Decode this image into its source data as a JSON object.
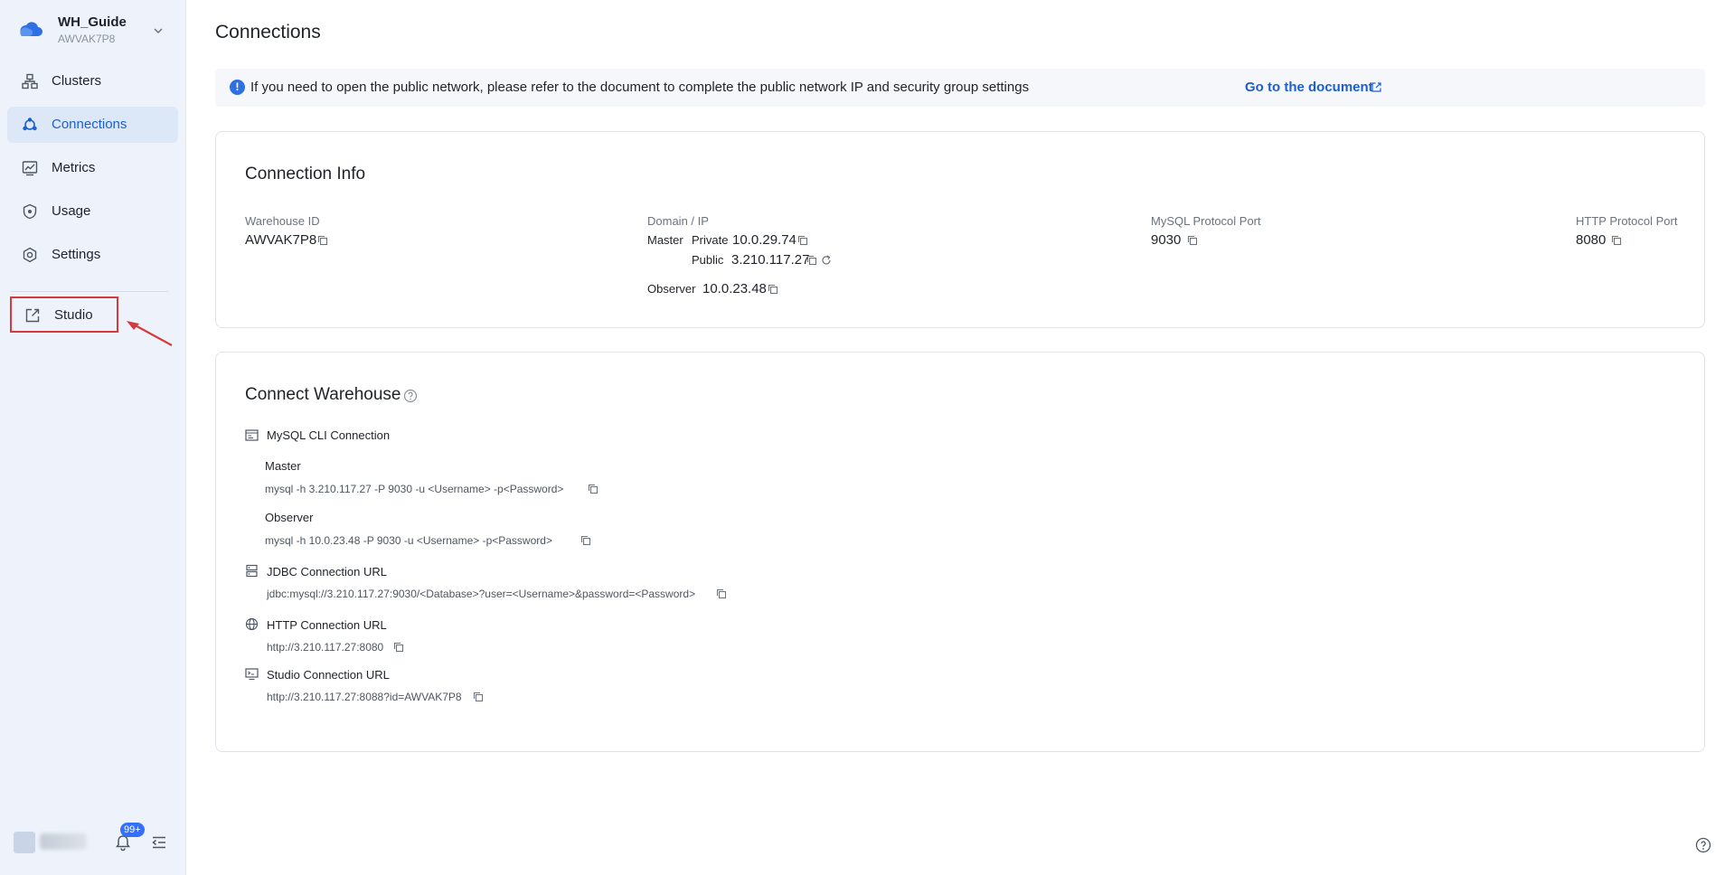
{
  "workspace": {
    "name": "WH_Guide",
    "id": "AWVAK7P8"
  },
  "nav": {
    "clusters": "Clusters",
    "connections": "Connections",
    "metrics": "Metrics",
    "usage": "Usage",
    "settings": "Settings",
    "studio": "Studio"
  },
  "footer": {
    "notification_count": "99+"
  },
  "page": {
    "title": "Connections"
  },
  "notice": {
    "text": "If you need to open the public network, please refer to the document to complete the public network IP and security group settings",
    "link": "Go to the document"
  },
  "connection_info": {
    "title": "Connection Info",
    "warehouse_id_label": "Warehouse ID",
    "warehouse_id": "AWVAK7P8",
    "domain_label": "Domain / IP",
    "master_label": "Master",
    "private_label": "Private",
    "private_ip": "10.0.29.74",
    "public_label": "Public",
    "public_ip": "3.210.117.27",
    "observer_label": "Observer",
    "observer_ip": "10.0.23.48",
    "mysql_port_label": "MySQL Protocol Port",
    "mysql_port": "9030",
    "http_port_label": "HTTP Protocol Port",
    "http_port": "8080"
  },
  "connect_warehouse": {
    "title": "Connect Warehouse",
    "mysql_cli": {
      "title": "MySQL CLI Connection",
      "master_label": "Master",
      "master_cmd": "mysql -h 3.210.117.27 -P 9030 -u <Username> -p<Password>",
      "observer_label": "Observer",
      "observer_cmd": "mysql -h 10.0.23.48 -P 9030 -u <Username> -p<Password>"
    },
    "jdbc": {
      "title": "JDBC Connection URL",
      "url": "jdbc:mysql://3.210.117.27:9030/<Database>?user=<Username>&password=<Password>"
    },
    "http": {
      "title": "HTTP Connection URL",
      "url": "http://3.210.117.27:8080"
    },
    "studio": {
      "title": "Studio Connection URL",
      "url": "http://3.210.117.27:8088?id=AWVAK7P8"
    }
  },
  "colors": {
    "accent": "#1d5fd1",
    "sidebar_bg": "#eef3fb",
    "highlight_box": "#d63a3a"
  }
}
